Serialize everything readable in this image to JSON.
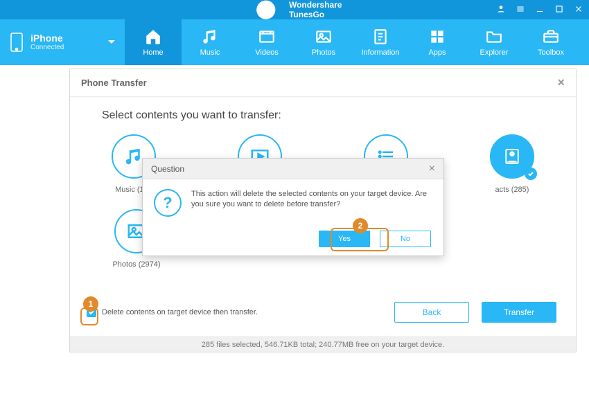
{
  "titlebar": {
    "title": "Wondershare TunesGo"
  },
  "device": {
    "name": "iPhone",
    "status": "Connected"
  },
  "nav": [
    {
      "label": "Home"
    },
    {
      "label": "Music"
    },
    {
      "label": "Videos"
    },
    {
      "label": "Photos"
    },
    {
      "label": "Information"
    },
    {
      "label": "Apps"
    },
    {
      "label": "Explorer"
    },
    {
      "label": "Toolbox"
    }
  ],
  "panel": {
    "title": "Phone Transfer",
    "heading": "Select contents you want to transfer:",
    "categories": {
      "music": "Music (189",
      "contacts": "acts (285)",
      "photos": "Photos (2974)"
    },
    "delete_opt": "Delete contents on target device then transfer.",
    "back": "Back",
    "transfer": "Transfer",
    "status": "285 files selected, 546.71KB total; 240.77MB free on your target device."
  },
  "question": {
    "title": "Question",
    "message": "This action will delete the selected contents on your target device. Are you sure you want to delete before transfer?",
    "yes": "Yes",
    "no": "No"
  },
  "callouts": {
    "one": "1",
    "two": "2"
  }
}
